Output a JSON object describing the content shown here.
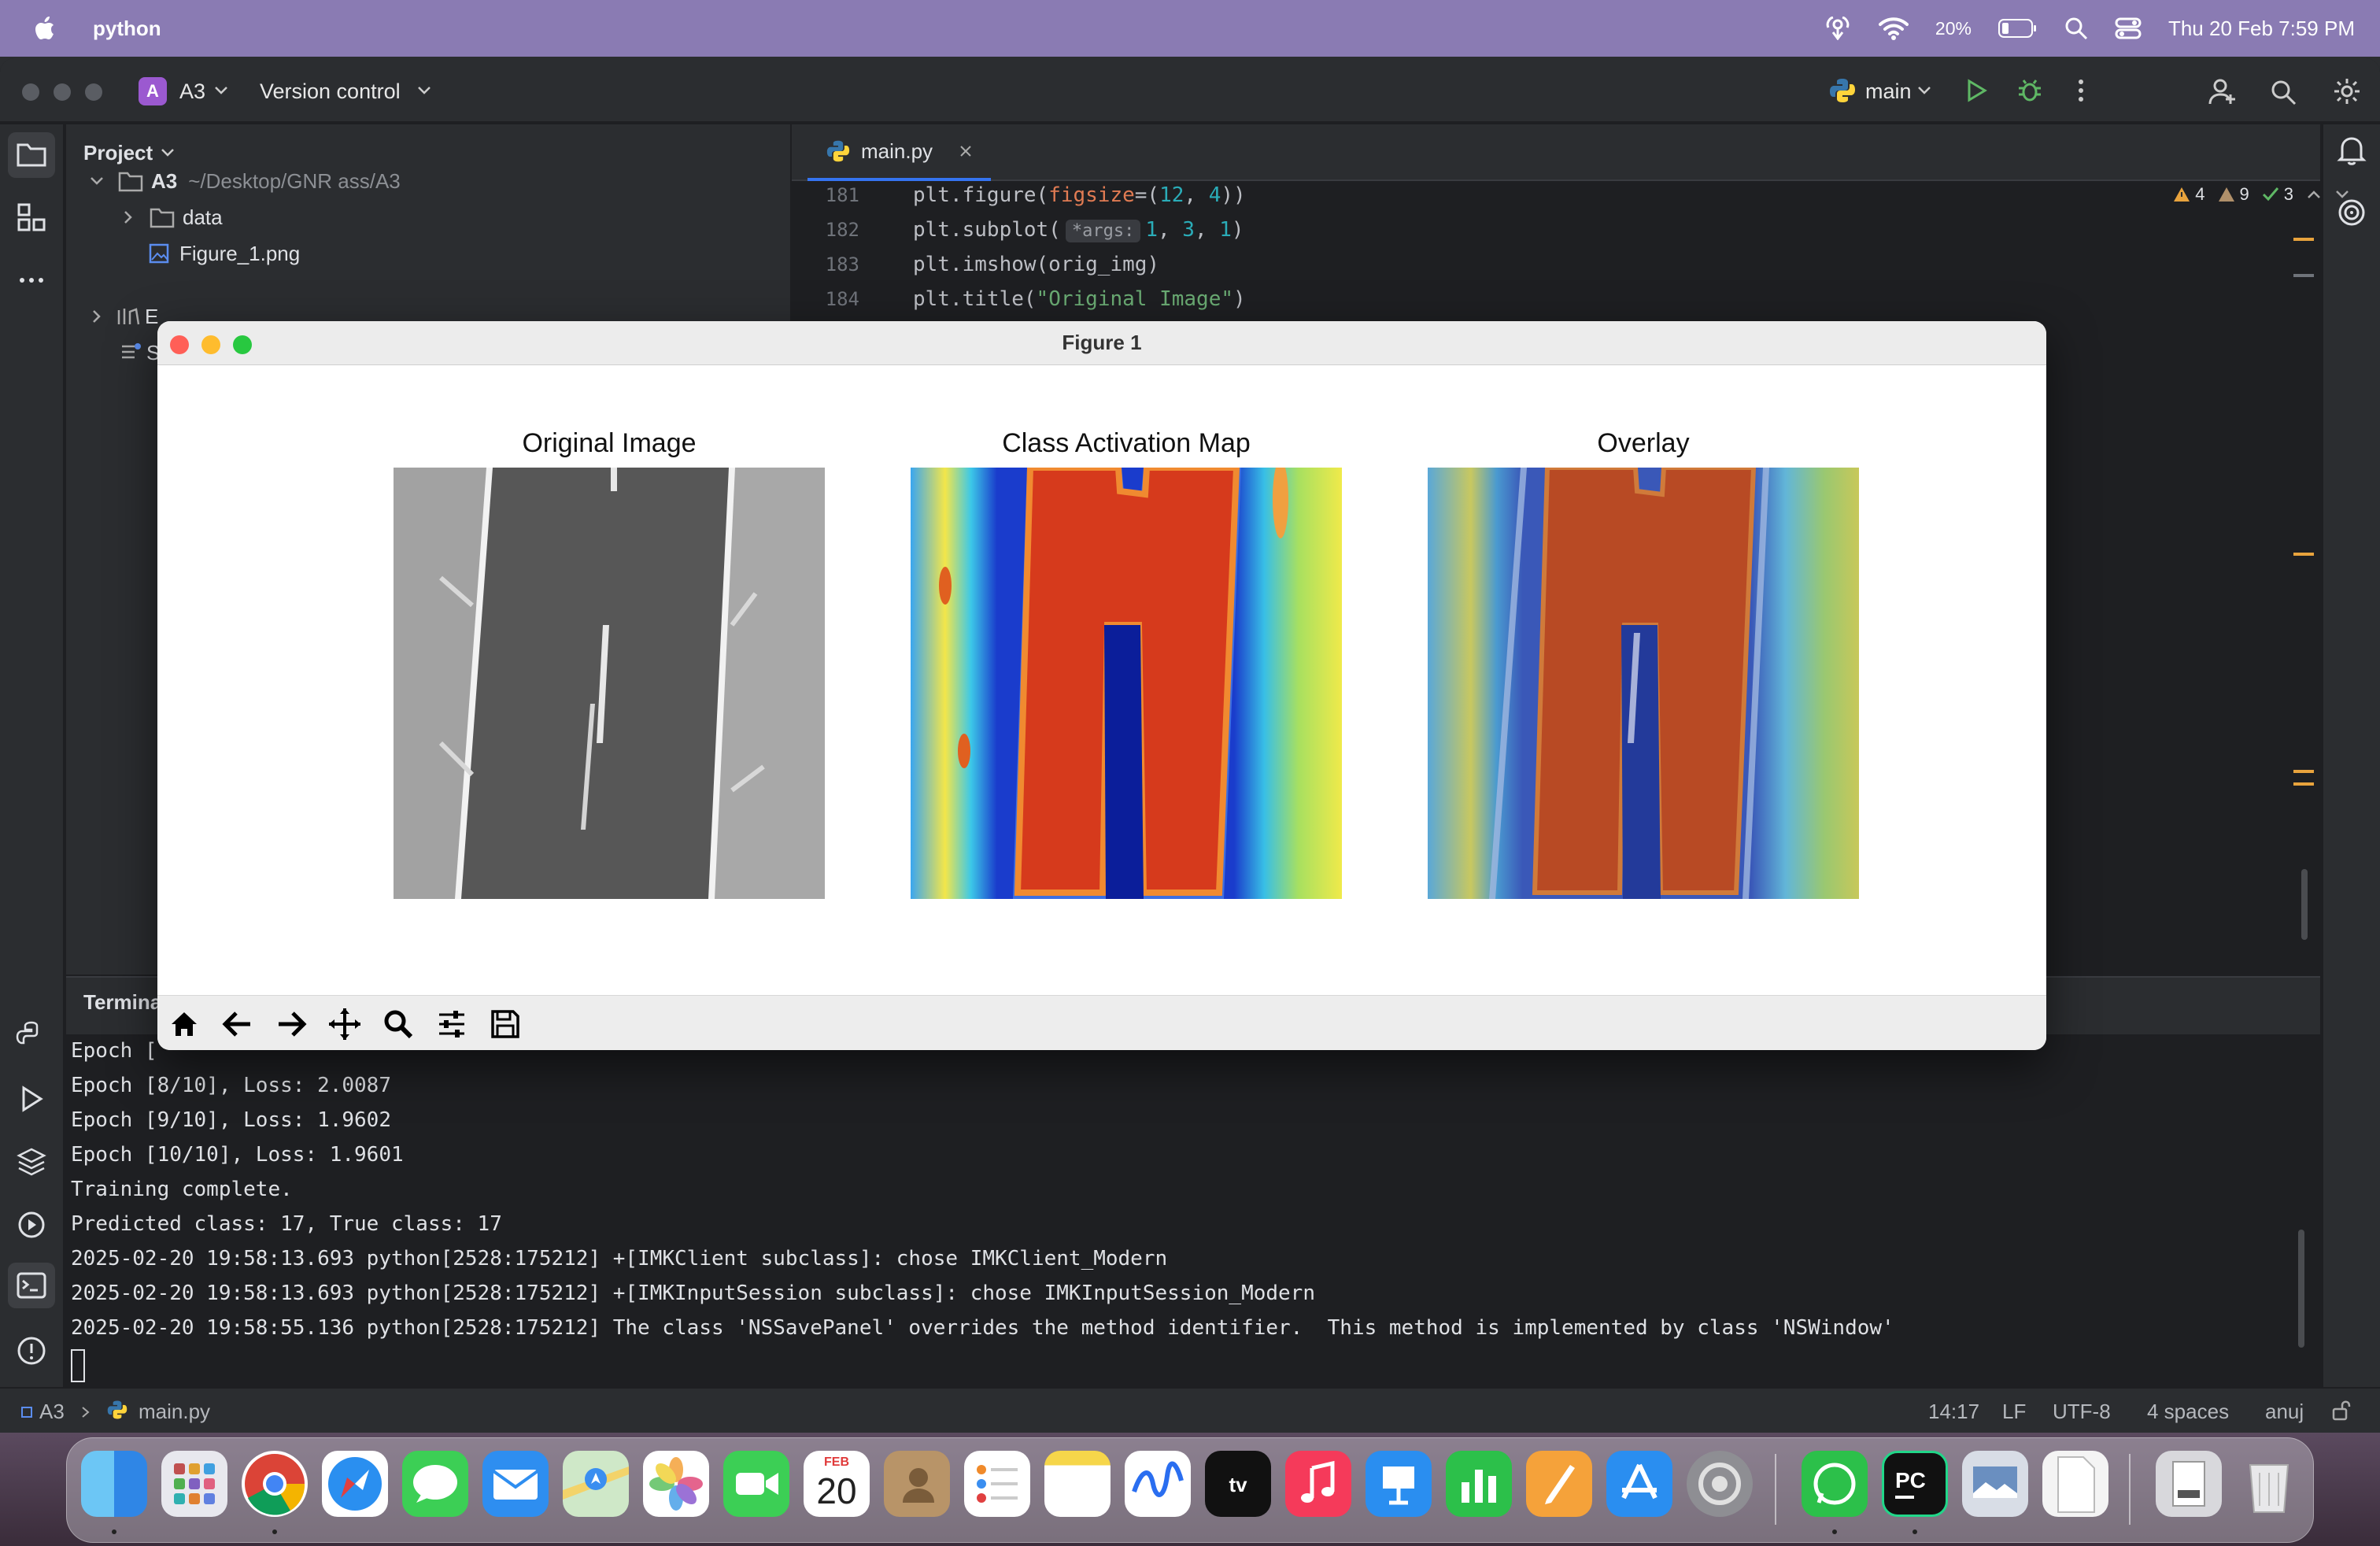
{
  "menubar": {
    "app_name": "python",
    "battery": "20%",
    "datetime": "Thu 20 Feb  7:59 PM"
  },
  "ide": {
    "project_badge": "A",
    "project_name": "A3",
    "vcs_label": "Version control",
    "branch": "main",
    "project_panel": {
      "title": "Project",
      "root": "A3",
      "root_path": "~/Desktop/GNR ass/A3",
      "items": [
        "data",
        "Figure_1.png"
      ],
      "partial_items": [
        "E",
        "S"
      ]
    },
    "editor": {
      "tab": "main.py",
      "lines": [
        {
          "num": "181"
        },
        {
          "num": "182",
          "hint": "*args:"
        },
        {
          "num": "183"
        },
        {
          "num": "184"
        }
      ],
      "inspections": {
        "warnings": "4",
        "weak_warnings": "9",
        "ok": "3"
      }
    },
    "terminal": {
      "title": "Termina",
      "lines": [
        "Epoch [",
        "Epoch [8/10], Loss: 2.0087",
        "Epoch [9/10], Loss: 1.9602",
        "Epoch [10/10], Loss: 1.9601",
        "Training complete.",
        "Predicted class: 17, True class: 17",
        "2025-02-20 19:58:13.693 python[2528:175212] +[IMKClient subclass]: chose IMKClient_Modern",
        "2025-02-20 19:58:13.693 python[2528:175212] +[IMKInputSession subclass]: chose IMKInputSession_Modern",
        "2025-02-20 19:58:55.136 python[2528:175212] The class 'NSSavePanel' overrides the method identifier.  This method is implemented by class 'NSWindow'"
      ]
    },
    "statusbar": {
      "breadcrumb_root": "A3",
      "breadcrumb_file": "main.py",
      "position": "14:17",
      "line_sep": "LF",
      "encoding": "UTF-8",
      "indent": "4 spaces",
      "user": "anuj"
    }
  },
  "figure": {
    "window_title": "Figure 1",
    "subplots": [
      {
        "title": "Original Image"
      },
      {
        "title": "Class Activation Map"
      },
      {
        "title": "Overlay"
      }
    ],
    "toolbar": [
      "home-icon",
      "back-icon",
      "forward-icon",
      "pan-icon",
      "zoom-icon",
      "configure-icon",
      "save-icon"
    ]
  },
  "dock": {
    "calendar_month": "FEB",
    "calendar_day": "20",
    "apps": [
      "Finder",
      "Launchpad",
      "Chrome",
      "Safari",
      "Messages",
      "Mail",
      "Maps",
      "Photos",
      "FaceTime",
      "Calendar",
      "Contacts",
      "Reminders",
      "Notes",
      "Freeform",
      "TV",
      "Music",
      "Keynote",
      "Numbers",
      "Pages",
      "App Store",
      "System Settings",
      "WhatsApp",
      "PyCharm",
      "Preview",
      "Document",
      "Downloads",
      "Trash"
    ]
  }
}
